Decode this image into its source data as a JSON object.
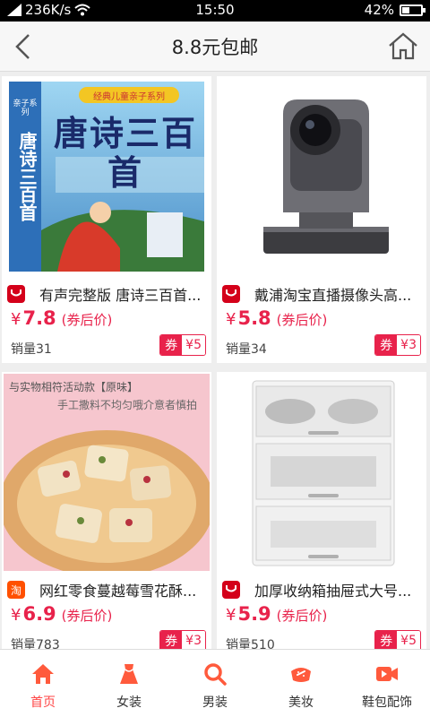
{
  "status": {
    "speed": "236K/s",
    "time": "15:50",
    "battery": "42%",
    "battery_level": 0.42
  },
  "header": {
    "title": "8.8元包邮"
  },
  "products": [
    {
      "shop_type": "tmall",
      "name": "有声完整版 唐诗三百首...",
      "price_symbol": "¥",
      "price": "7.8",
      "price_note": "(券后价)",
      "sales": "销量31",
      "coupon_tag": "券",
      "coupon_amount": "¥5",
      "cover": {
        "banner": "经典儿童亲子系列",
        "title": "唐诗三百首",
        "spine": "唐诗三百首",
        "series": "亲子系列"
      }
    },
    {
      "shop_type": "tmall",
      "name": "戴浦淘宝直播摄像头高...",
      "price_symbol": "¥",
      "price": "5.8",
      "price_note": "(券后价)",
      "sales": "销量34",
      "coupon_tag": "券",
      "coupon_amount": "¥3"
    },
    {
      "shop_type": "taobao",
      "name": "网红零食蔓越莓雪花酥...",
      "price_symbol": "¥",
      "price": "6.9",
      "price_note": "(券后价)",
      "sales": "销量783",
      "coupon_tag": "券",
      "coupon_amount": "¥3",
      "cover": {
        "line1": "与实物相符活动款【原味】",
        "line2": "手工撒料不均匀哦介意者慎拍"
      }
    },
    {
      "shop_type": "tmall",
      "name": "加厚收纳箱抽屉式大号...",
      "price_symbol": "¥",
      "price": "5.9",
      "price_note": "(券后价)",
      "sales": "销量510",
      "coupon_tag": "券",
      "coupon_amount": "¥5"
    }
  ],
  "tabs": [
    {
      "label": "首页",
      "icon": "home-icon",
      "active": true
    },
    {
      "label": "女装",
      "icon": "dress-icon",
      "active": false
    },
    {
      "label": "男装",
      "icon": "search-icon",
      "active": false
    },
    {
      "label": "美妆",
      "icon": "makeup-icon",
      "active": false
    },
    {
      "label": "鞋包配饰",
      "icon": "video-icon",
      "active": false
    }
  ],
  "colors": {
    "accent": "#e8224b",
    "tab_active": "#ff4444",
    "tab_icon": "#ff5a3c"
  }
}
